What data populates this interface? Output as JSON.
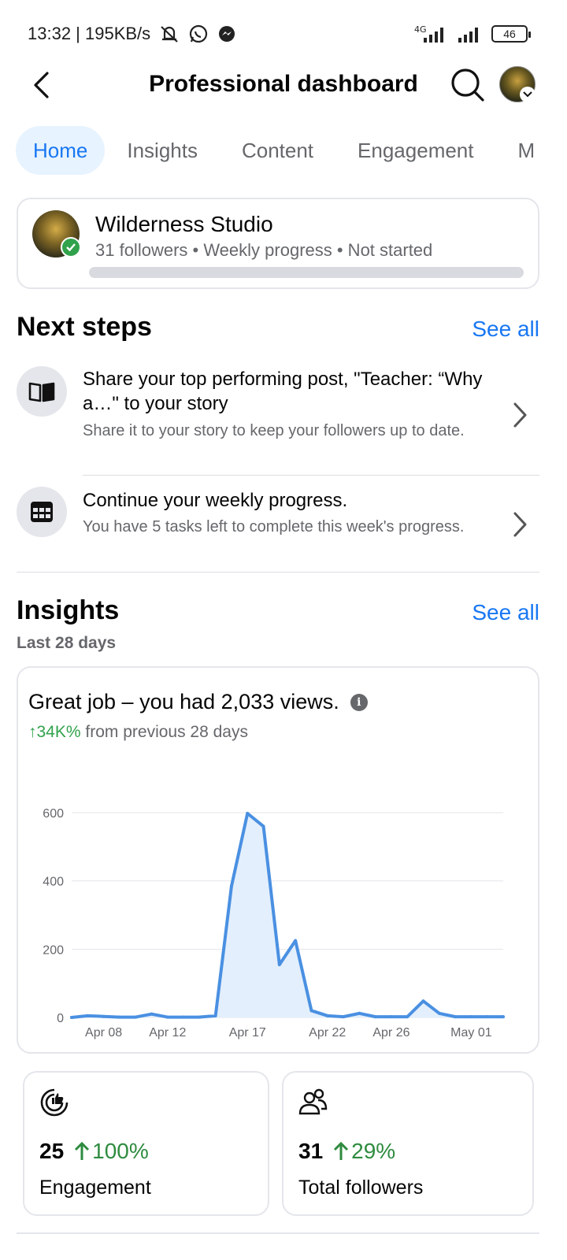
{
  "status_bar": {
    "time_speed": "13:32 | 195KB/s",
    "network": "4G",
    "battery": "46"
  },
  "header": {
    "title": "Professional dashboard"
  },
  "tabs": [
    {
      "label": "Home",
      "active": true
    },
    {
      "label": "Insights",
      "active": false
    },
    {
      "label": "Content",
      "active": false
    },
    {
      "label": "Engagement",
      "active": false
    },
    {
      "label": "M",
      "active": false
    }
  ],
  "profile": {
    "name": "Wilderness Studio",
    "meta": "31 followers • Weekly progress • Not started",
    "progress": 0
  },
  "next_steps": {
    "heading": "Next steps",
    "see_all": "See all",
    "items": [
      {
        "icon": "book-icon",
        "title": "Share your top performing post, \"Teacher: “Why a…\" to your story",
        "desc": "Share it to your story to keep your followers up to date."
      },
      {
        "icon": "calendar-grid-icon",
        "title": "Continue your weekly progress.",
        "desc": "You have 5 tasks left to complete this week's progress."
      }
    ]
  },
  "insights": {
    "heading": "Insights",
    "see_all": "See all",
    "period": "Last 28 days",
    "headline": "Great job – you had 2,033 views.",
    "change_value": "↑34K%",
    "change_text": " from previous 28 days"
  },
  "chart_data": {
    "type": "area",
    "x": [
      "Apr 06",
      "Apr 07",
      "Apr 08",
      "Apr 09",
      "Apr 10",
      "Apr 11",
      "Apr 12",
      "Apr 13",
      "Apr 14",
      "Apr 15",
      "Apr 16",
      "Apr 17",
      "Apr 18",
      "Apr 19",
      "Apr 20",
      "Apr 21",
      "Apr 22",
      "Apr 23",
      "Apr 24",
      "Apr 25",
      "Apr 26",
      "Apr 27",
      "Apr 28",
      "Apr 29",
      "Apr 30",
      "May 01",
      "May 02",
      "May 03"
    ],
    "series": [
      {
        "values": [
          0,
          5,
          3,
          1,
          1,
          10,
          1,
          1,
          1,
          5,
          385,
          598,
          560,
          155,
          225,
          20,
          5,
          2,
          12,
          2,
          2,
          2,
          48,
          12,
          2,
          2,
          2,
          2
        ]
      }
    ],
    "x_tick_labels": [
      "Apr 08",
      "Apr 12",
      "Apr 17",
      "Apr 22",
      "Apr 26",
      "May 01"
    ],
    "y_ticks": [
      0,
      200,
      400,
      600
    ],
    "ylim": [
      0,
      600
    ],
    "line_color": "#4a90e2",
    "fill_color": "#e3effc",
    "grid": true
  },
  "stats": [
    {
      "icon": "engagement-icon",
      "value": "25",
      "change": "100%",
      "label": "Engagement"
    },
    {
      "icon": "followers-icon",
      "value": "31",
      "change": "29%",
      "label": "Total followers"
    }
  ],
  "colors": {
    "accent": "#1877f2",
    "positive": "#2e8b3f",
    "muted_text": "#65676b",
    "border": "#e4e6eb"
  }
}
